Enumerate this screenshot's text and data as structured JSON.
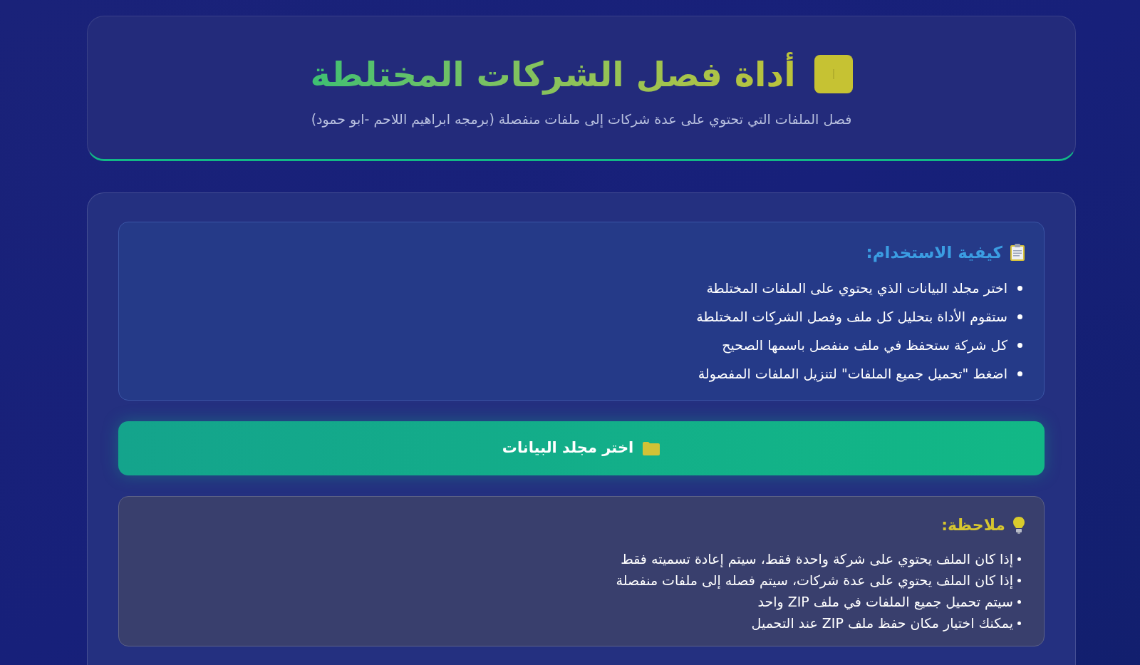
{
  "header": {
    "title": "أداة فصل الشركات المختلطة",
    "subtitle": "فصل الملفات التي تحتوي على عدة شركات إلى ملفات منفصلة (برمجه ابراهيم اللاحم -ابو حمود)"
  },
  "instructions": {
    "heading": "كيفية الاستخدام:",
    "items": [
      "اختر مجلد البيانات الذي يحتوي على الملفات المختلطة",
      "ستقوم الأداة بتحليل كل ملف وفصل الشركات المختلطة",
      "كل شركة ستحفظ في ملف منفصل باسمها الصحيح",
      "اضغط \"تحميل جميع الملفات\" لتنزيل الملفات المفصولة"
    ]
  },
  "select_button": {
    "label": "اختر مجلد البيانات"
  },
  "note": {
    "heading": "ملاحظة:",
    "items": [
      "إذا كان الملف يحتوي على شركة واحدة فقط، سيتم إعادة تسميته فقط",
      "إذا كان الملف يحتوي على عدة شركات، سيتم فصله إلى ملفات منفصلة",
      "سيتم تحميل جميع الملفات في ملف ZIP واحد",
      "يمكنك اختيار مكان حفظ ملف ZIP عند التحميل"
    ]
  }
}
